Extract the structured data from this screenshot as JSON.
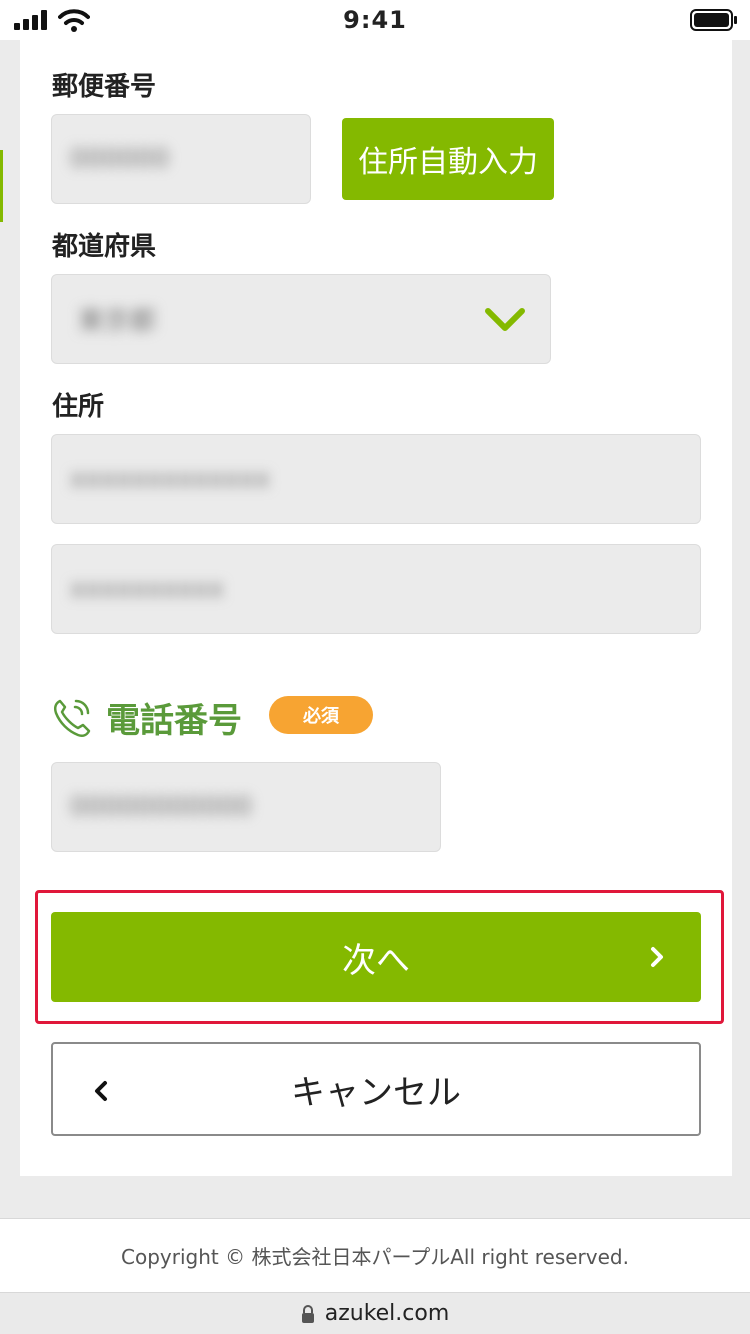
{
  "status_bar": {
    "time": "9:41"
  },
  "form": {
    "postal_code": {
      "label": "郵便番号",
      "value": "000000",
      "auto_fill_button": "住所自動入力"
    },
    "prefecture": {
      "label": "都道府県",
      "value": "東京都"
    },
    "address": {
      "label": "住所",
      "line1": "xxxxxxxxxxxxx",
      "line2": "xxxxxxxxxx"
    },
    "phone": {
      "label": "電話番号",
      "required_badge": "必須",
      "value": "00000000000"
    }
  },
  "actions": {
    "next_label": "次へ",
    "cancel_label": "キャンセル"
  },
  "footer": {
    "copyright": "Copyright © 株式会社日本パープルAll right reserved."
  },
  "browser": {
    "url": "azukel.com"
  },
  "colors": {
    "accent_green": "#84b900",
    "phone_green": "#5a9a3a",
    "badge_orange": "#f7a432",
    "highlight_red": "#e0173a"
  }
}
